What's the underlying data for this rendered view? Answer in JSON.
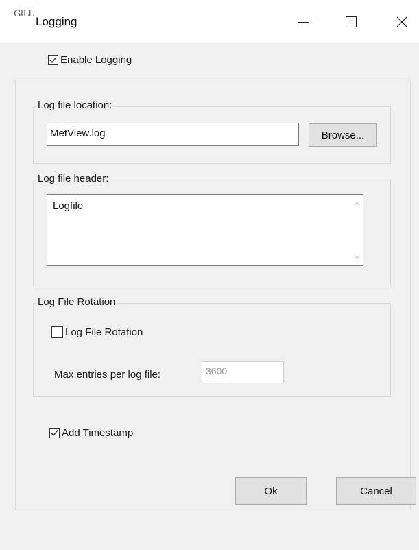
{
  "window": {
    "icon_text": "GILL",
    "title": "Logging",
    "controls": [
      "minimize-icon",
      "maximize-icon",
      "close-icon"
    ]
  },
  "enable_logging": {
    "label": "Enable Logging",
    "checked": true
  },
  "log_file_location": {
    "group_label": "Log file location:",
    "value": "MetView.log",
    "browse_label": "Browse..."
  },
  "log_file_header": {
    "group_label": "Log file header:",
    "value": "Logfile"
  },
  "log_file_rotation": {
    "group_label": "Log File Rotation",
    "checkbox_label": "Log File Rotation",
    "checked": false,
    "max_entries_label": "Max entries per log file:",
    "max_entries_value": "3600"
  },
  "add_timestamp": {
    "label": "Add Timestamp",
    "checked": true
  },
  "buttons": {
    "ok": "Ok",
    "cancel": "Cancel"
  }
}
